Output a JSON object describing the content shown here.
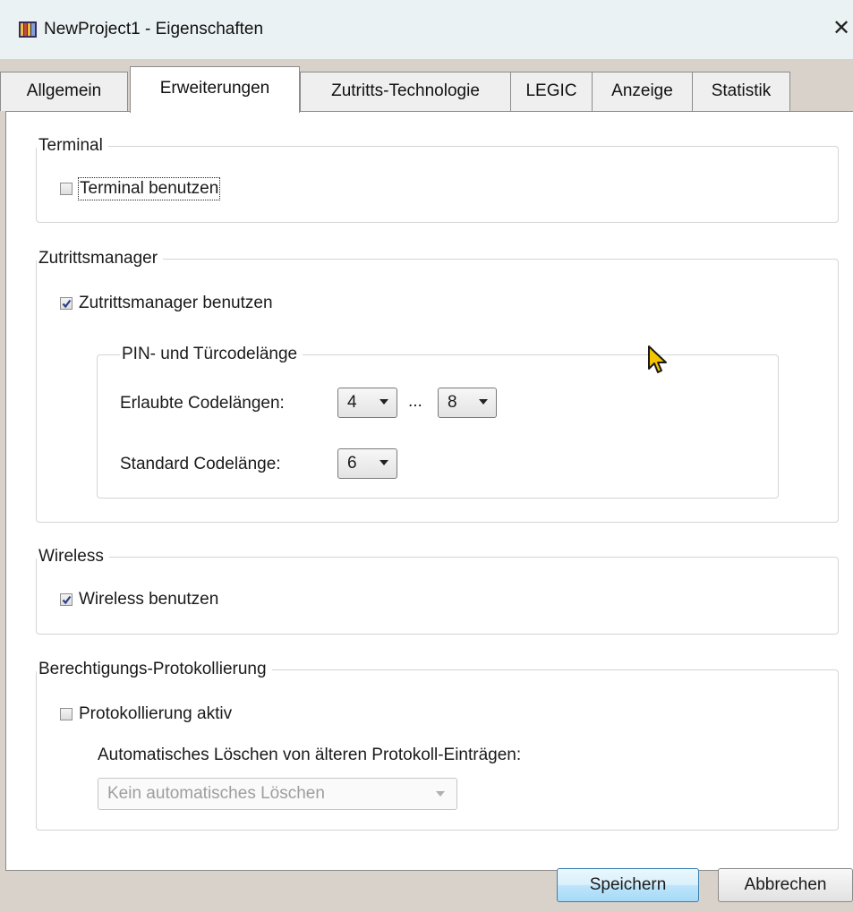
{
  "window": {
    "title": "NewProject1 - Eigenschaften",
    "app_icon": "project-properties-icon",
    "close_glyph": "✕"
  },
  "tabs": [
    {
      "label": "Allgemein"
    },
    {
      "label": "Erweiterungen",
      "active": true
    },
    {
      "label": "Zutritts-Technologie"
    },
    {
      "label": "LEGIC"
    },
    {
      "label": "Anzeige"
    },
    {
      "label": "Statistik"
    }
  ],
  "terminal": {
    "legend": "Terminal",
    "checkbox_label": "Terminal benutzen",
    "checked": false
  },
  "access_manager": {
    "legend": "Zutrittsmanager",
    "checkbox_label": "Zutrittsmanager benutzen",
    "checked": true,
    "pin": {
      "legend": "PIN- und Türcodelänge",
      "allowed_label": "Erlaubte Codelängen:",
      "min_value": "4",
      "range_separator": "...",
      "max_value": "8",
      "default_label": "Standard Codelänge:",
      "default_value": "6"
    }
  },
  "wireless": {
    "legend": "Wireless",
    "checkbox_label": "Wireless benutzen",
    "checked": true
  },
  "logging": {
    "legend": "Berechtigungs-Protokollierung",
    "checkbox_label": "Protokollierung aktiv",
    "checked": false,
    "auto_delete_label": "Automatisches Löschen von älteren Protokoll-Einträgen:",
    "auto_delete_value": "Kein automatisches Löschen"
  },
  "buttons": {
    "save": "Speichern",
    "cancel": "Abbrechen"
  },
  "colors": {
    "titlebar": "#ebf2f3",
    "dialog_frame": "#d8d2cb",
    "check": "#2b3f8a",
    "primary_button_border": "#3c7fb1"
  }
}
